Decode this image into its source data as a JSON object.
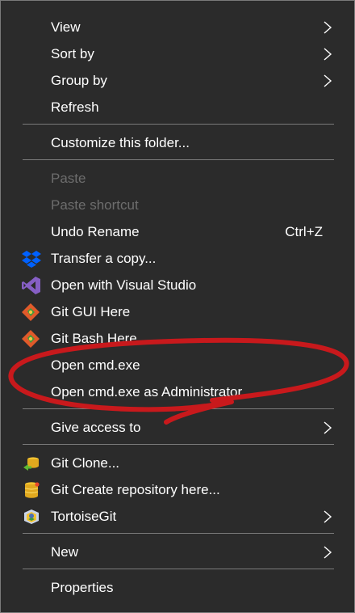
{
  "menu": {
    "view": "View",
    "sort_by": "Sort by",
    "group_by": "Group by",
    "refresh": "Refresh",
    "customize": "Customize this folder...",
    "paste": "Paste",
    "paste_shortcut": "Paste shortcut",
    "undo_rename": "Undo Rename",
    "undo_shortcut": "Ctrl+Z",
    "transfer_copy": "Transfer a copy...",
    "open_vs": "Open with Visual Studio",
    "git_gui": "Git GUI Here",
    "git_bash": "Git Bash Here",
    "open_cmd": "Open cmd.exe",
    "open_cmd_admin": "Open cmd.exe as Administrator",
    "give_access": "Give access to",
    "git_clone": "Git Clone...",
    "git_create": "Git Create repository here...",
    "tortoisegit": "TortoiseGit",
    "new": "New",
    "properties": "Properties"
  },
  "icons": {
    "dropbox": "dropbox-icon",
    "visual_studio": "visual-studio-icon",
    "git_gui": "git-gui-icon",
    "git_bash": "git-bash-icon",
    "git_clone": "git-clone-icon",
    "git_create": "git-create-icon",
    "tortoisegit": "tortoisegit-icon",
    "submenu": "chevron-right-icon"
  },
  "colors": {
    "background": "#2b2b2b",
    "text": "#ffffff",
    "disabled_text": "#6d6d6d",
    "separator": "#7a7a7a",
    "annotation_red": "#c8191c"
  }
}
